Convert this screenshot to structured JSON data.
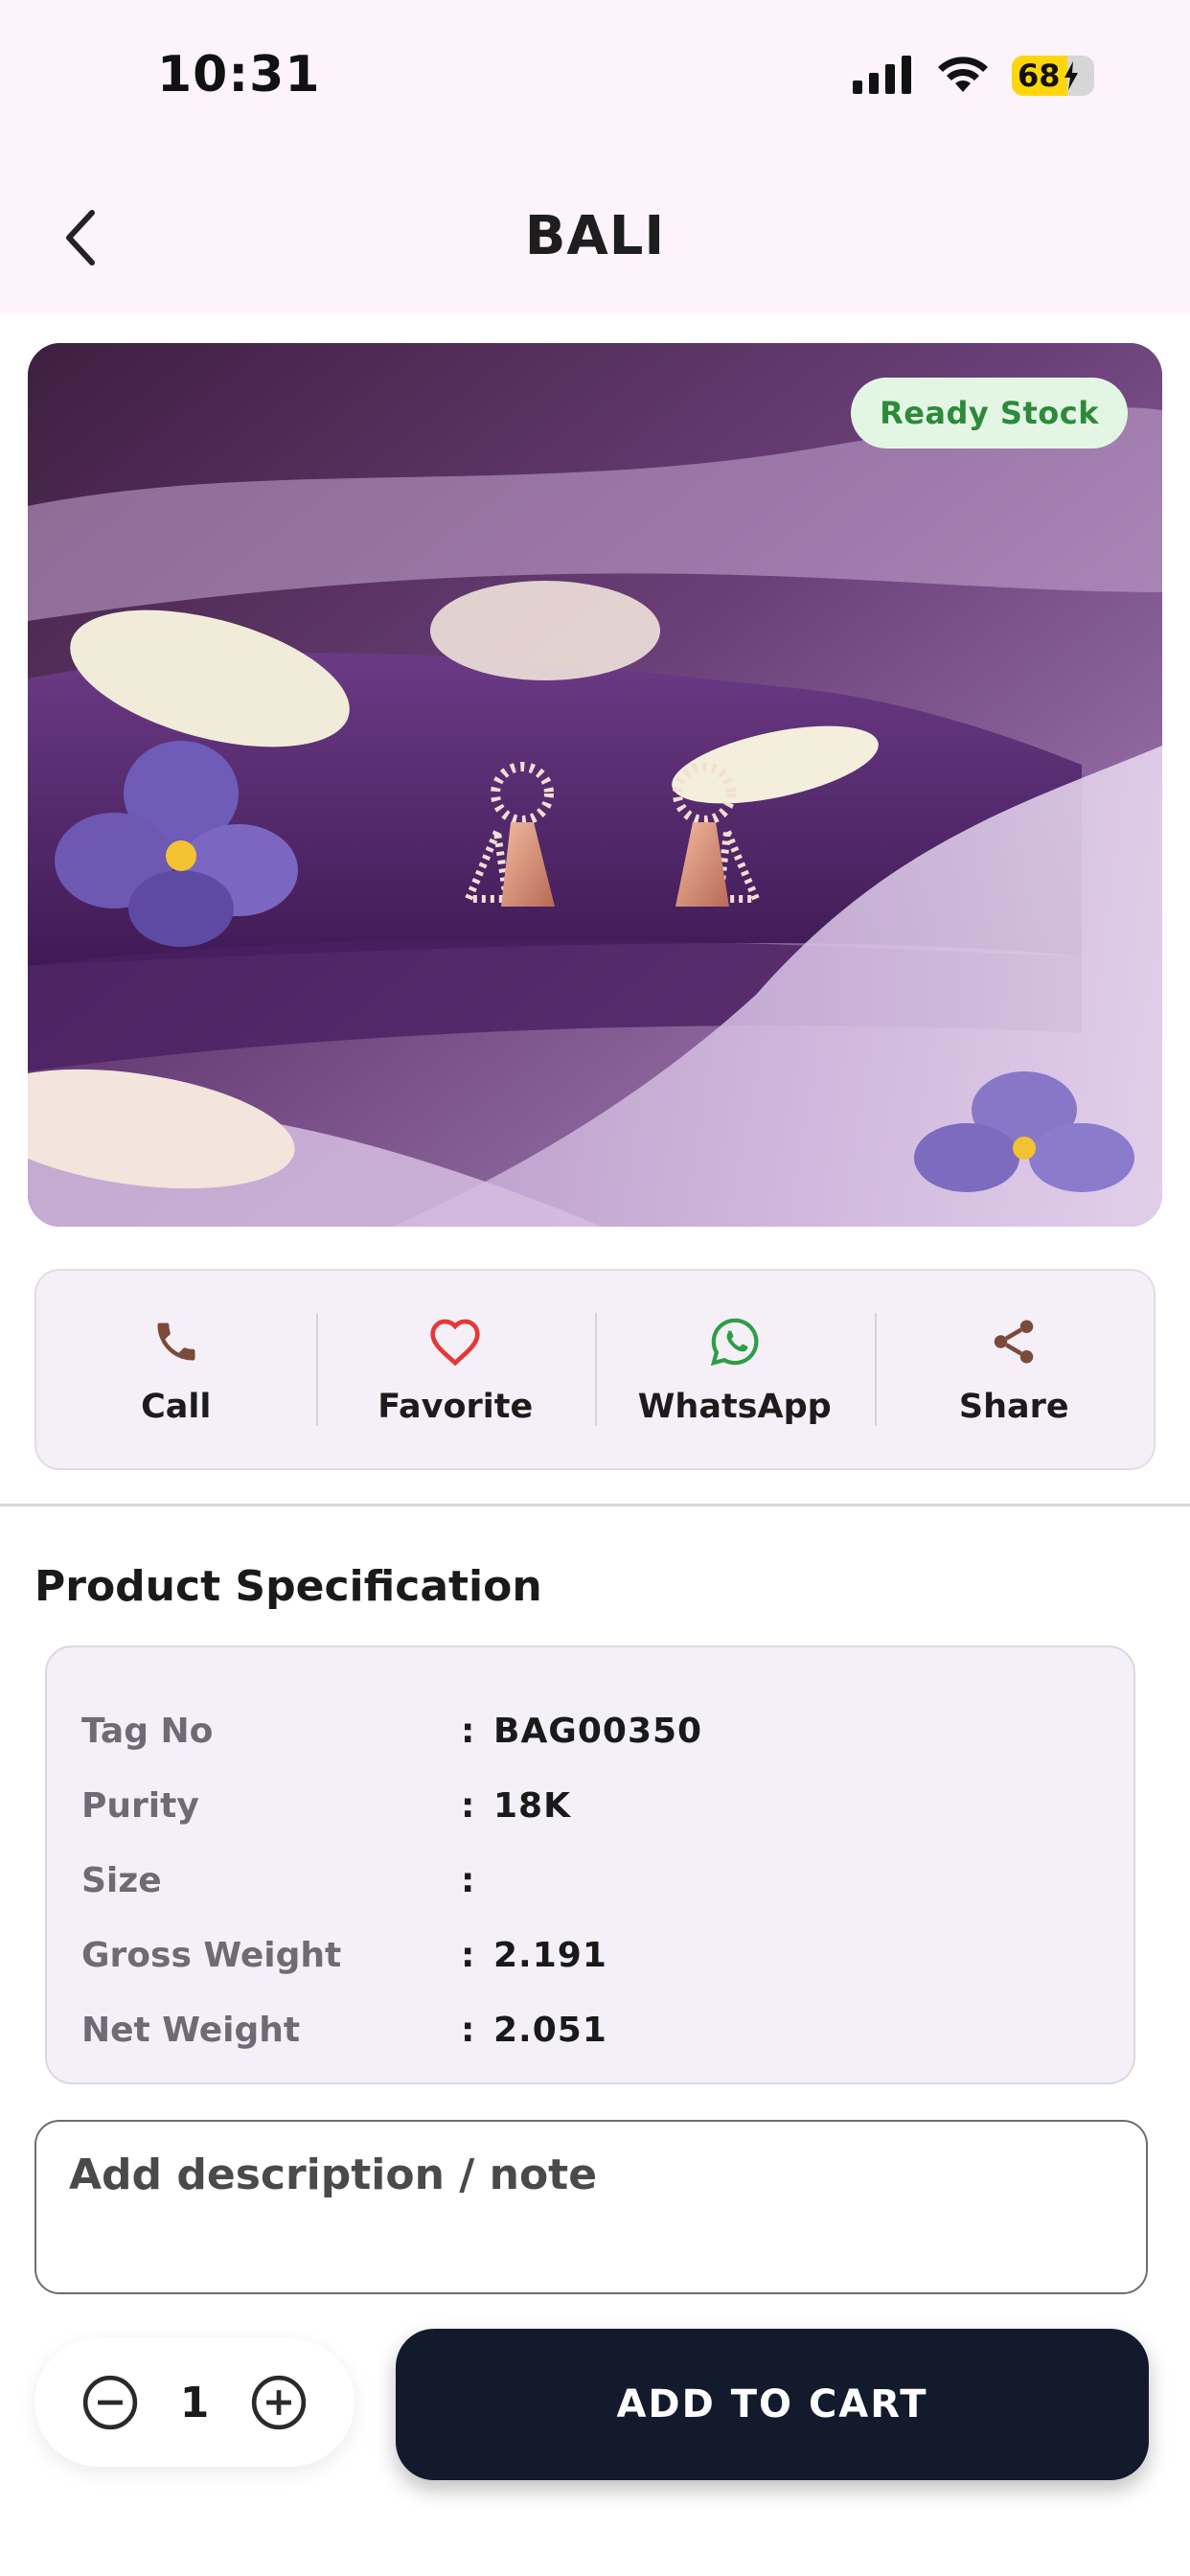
{
  "status_bar": {
    "time": "10:31",
    "battery_level": "68",
    "battery_fraction": 0.68,
    "icons": [
      "signal-icon",
      "wifi-icon",
      "battery-icon",
      "charging-bolt-icon"
    ]
  },
  "header": {
    "title": "BALI",
    "back_icon": "chevron-left-icon"
  },
  "product": {
    "badge": "Ready Stock",
    "image_description_icon": "earrings-photo"
  },
  "actions": [
    {
      "label": "Call",
      "icon": "phone-icon",
      "color": "#7a4a3a"
    },
    {
      "label": "Favorite",
      "icon": "heart-icon",
      "color": "#e53935"
    },
    {
      "label": "WhatsApp",
      "icon": "whatsapp-icon",
      "color": "#2e9e44"
    },
    {
      "label": "Share",
      "icon": "share-icon",
      "color": "#7a4a3a"
    }
  ],
  "specification": {
    "title": "Product Specification",
    "rows": [
      {
        "label": "Tag No",
        "separator": ":",
        "value": "BAG00350"
      },
      {
        "label": "Purity",
        "separator": ":",
        "value": "18K"
      },
      {
        "label": "Size",
        "separator": ":",
        "value": ""
      },
      {
        "label": "Gross Weight",
        "separator": ":",
        "value": "2.191"
      },
      {
        "label": "Net Weight",
        "separator": ":",
        "value": "2.051"
      }
    ]
  },
  "note": {
    "placeholder": "Add description / note",
    "value": ""
  },
  "cart": {
    "quantity": "1",
    "minus_icon": "minus-circle-icon",
    "plus_icon": "plus-circle-icon",
    "add_label": "ADD TO CART"
  },
  "colors": {
    "header_bg": "#fdf4fb",
    "badge_bg": "#e3f6e3",
    "badge_text": "#2d8a3a",
    "cart_button": "#121a2c"
  }
}
